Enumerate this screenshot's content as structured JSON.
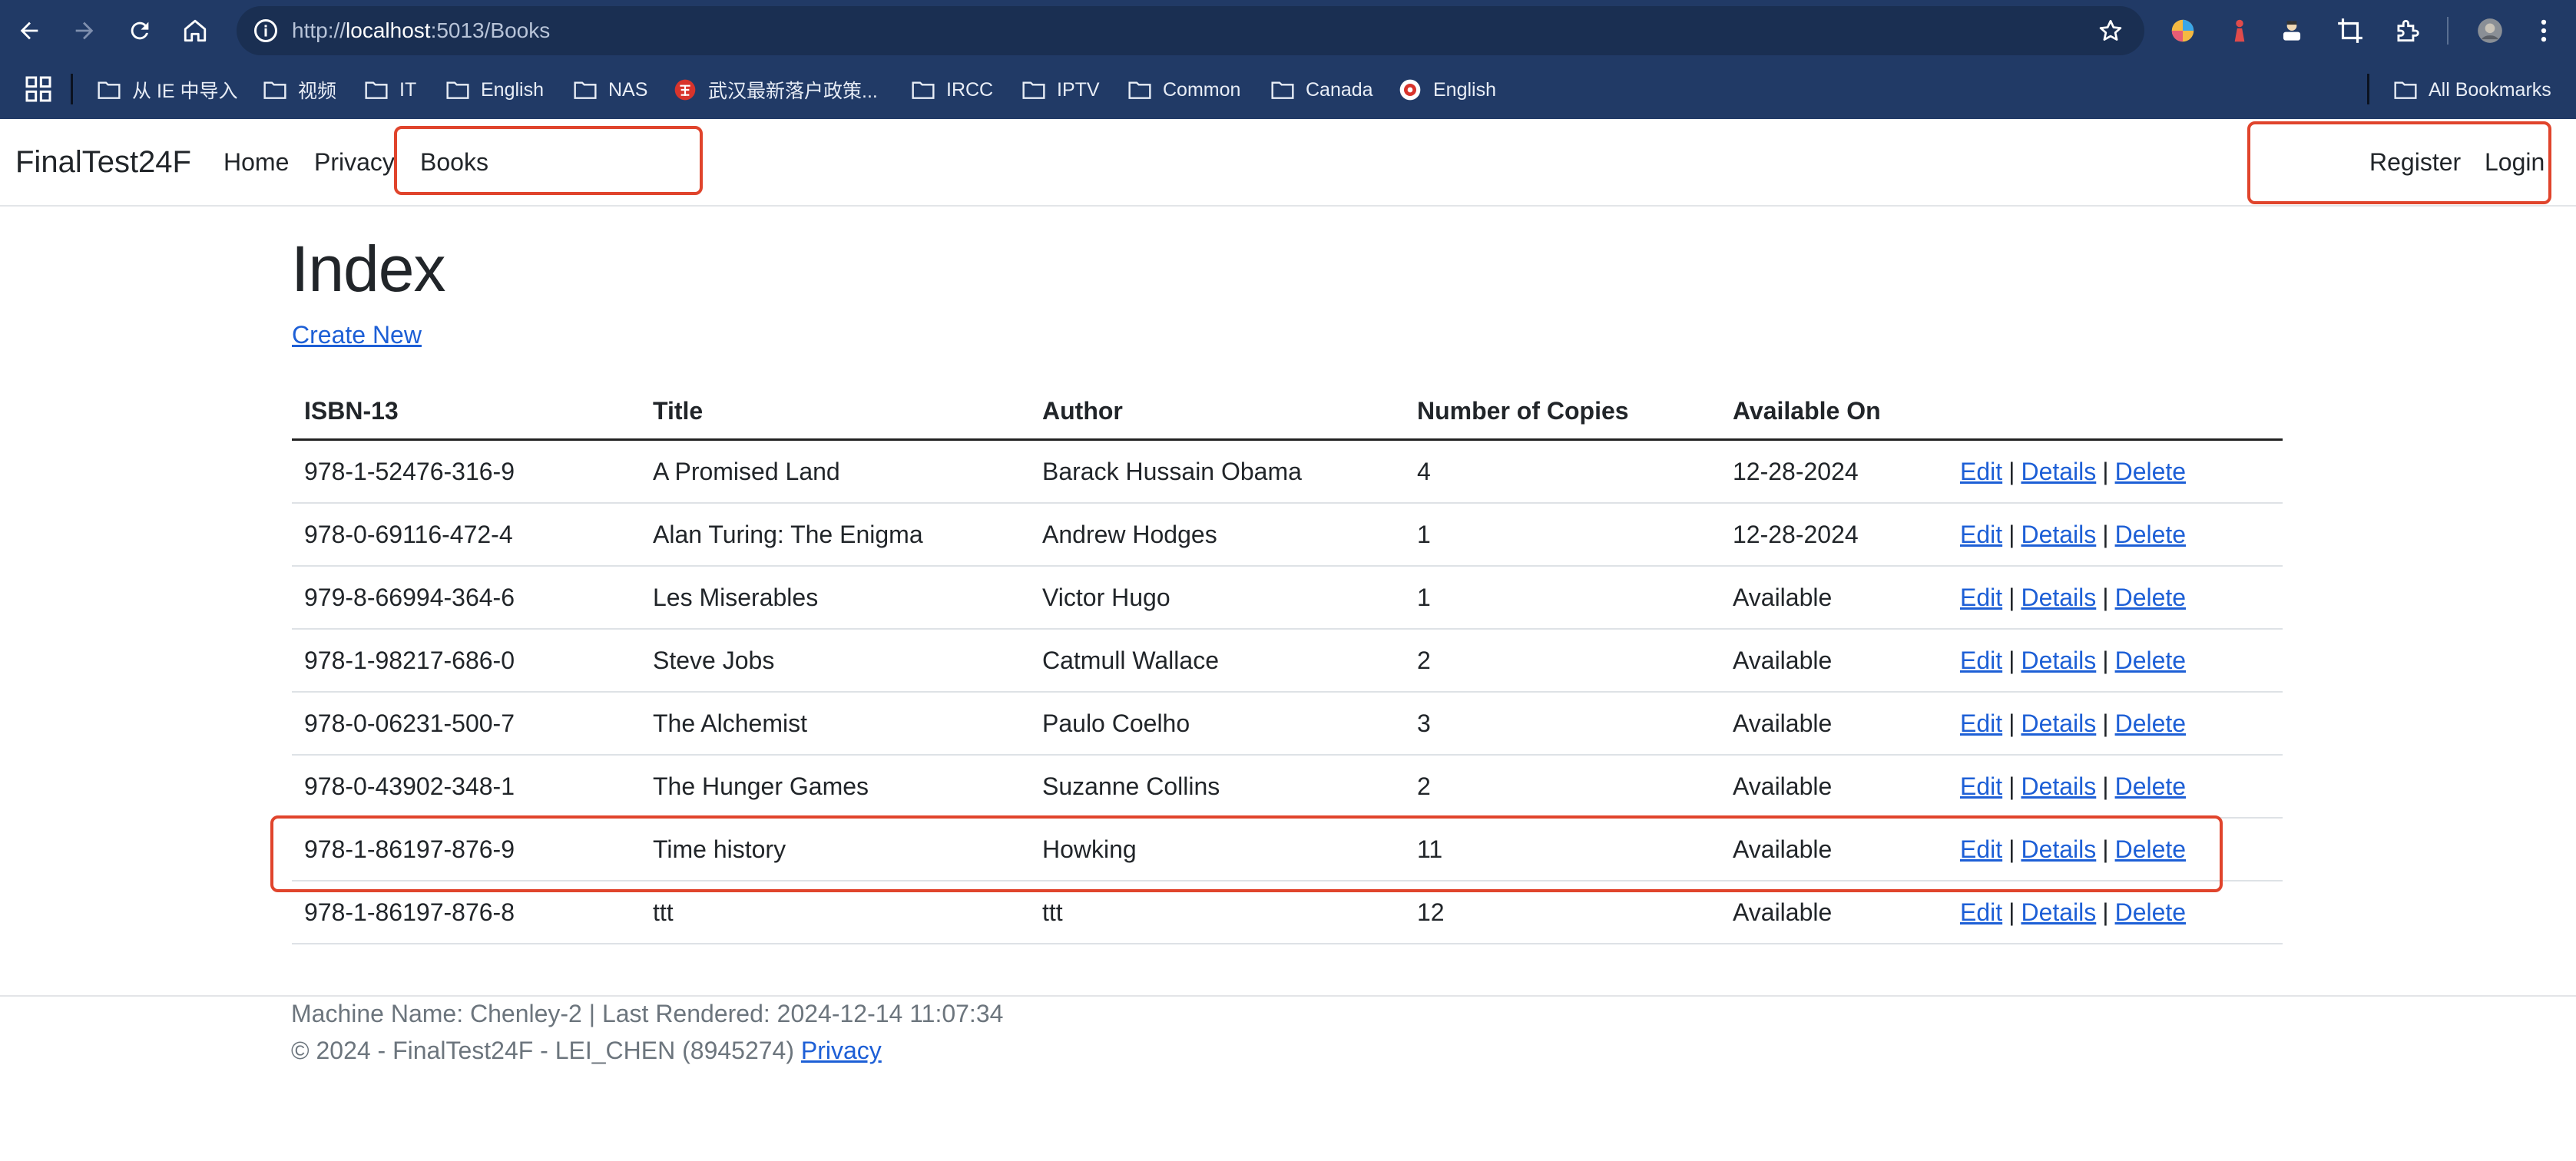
{
  "browser": {
    "url_prefix": "http://",
    "url_host": "localhost",
    "url_rest": ":5013/Books",
    "bookmarks": [
      {
        "label": "从 IE 中导入",
        "icon": "folder-icon"
      },
      {
        "label": "视频",
        "icon": "folder-icon"
      },
      {
        "label": "IT",
        "icon": "folder-icon"
      },
      {
        "label": "English",
        "icon": "folder-icon"
      },
      {
        "label": "NAS",
        "icon": "folder-icon"
      },
      {
        "label": "武汉最新落户政策...",
        "icon": "site-icon"
      },
      {
        "label": "IRCC",
        "icon": "folder-icon"
      },
      {
        "label": "IPTV",
        "icon": "folder-icon"
      },
      {
        "label": "Common",
        "icon": "folder-icon"
      },
      {
        "label": "Canada",
        "icon": "folder-icon"
      },
      {
        "label": "English",
        "icon": "globe-icon"
      }
    ],
    "all_bookmarks": "All Bookmarks"
  },
  "navbar": {
    "brand": "FinalTest24F",
    "links": [
      "Home",
      "Privacy",
      "Books"
    ],
    "register": "Register",
    "login": "Login"
  },
  "page": {
    "title": "Index",
    "create_new": "Create New"
  },
  "table": {
    "headers": [
      "ISBN-13",
      "Title",
      "Author",
      "Number of Copies",
      "Available On"
    ],
    "actions": {
      "edit": "Edit",
      "details": "Details",
      "delete": "Delete",
      "separator": "|"
    },
    "rows": [
      {
        "isbn": "978-1-52476-316-9",
        "title": "A Promised Land",
        "author": "Barack Hussain Obama",
        "copies": "4",
        "available": "12-28-2024"
      },
      {
        "isbn": "978-0-69116-472-4",
        "title": "Alan Turing: The Enigma",
        "author": "Andrew Hodges",
        "copies": "1",
        "available": "12-28-2024"
      },
      {
        "isbn": "979-8-66994-364-6",
        "title": "Les Miserables",
        "author": "Victor Hugo",
        "copies": "1",
        "available": "Available"
      },
      {
        "isbn": "978-1-98217-686-0",
        "title": "Steve Jobs",
        "author": "Catmull Wallace",
        "copies": "2",
        "available": "Available"
      },
      {
        "isbn": "978-0-06231-500-7",
        "title": "The Alchemist",
        "author": "Paulo Coelho",
        "copies": "3",
        "available": "Available"
      },
      {
        "isbn": "978-0-43902-348-1",
        "title": "The Hunger Games",
        "author": "Suzanne Collins",
        "copies": "2",
        "available": "Available"
      },
      {
        "isbn": "978-1-86197-876-9",
        "title": "Time history",
        "author": "Howking",
        "copies": "11",
        "available": "Available"
      },
      {
        "isbn": "978-1-86197-876-8",
        "title": "ttt",
        "author": "ttt",
        "copies": "12",
        "available": "Available"
      }
    ]
  },
  "footer": {
    "line1": "Machine Name: Chenley-2 | Last Rendered: 2024-12-14 11:07:34",
    "line2": "© 2024 - FinalTest24F - LEI_CHEN (8945274)",
    "privacy": "Privacy"
  },
  "colors": {
    "chrome": "#213a66",
    "link": "#1d5fd6",
    "annotation": "#e0442c"
  }
}
